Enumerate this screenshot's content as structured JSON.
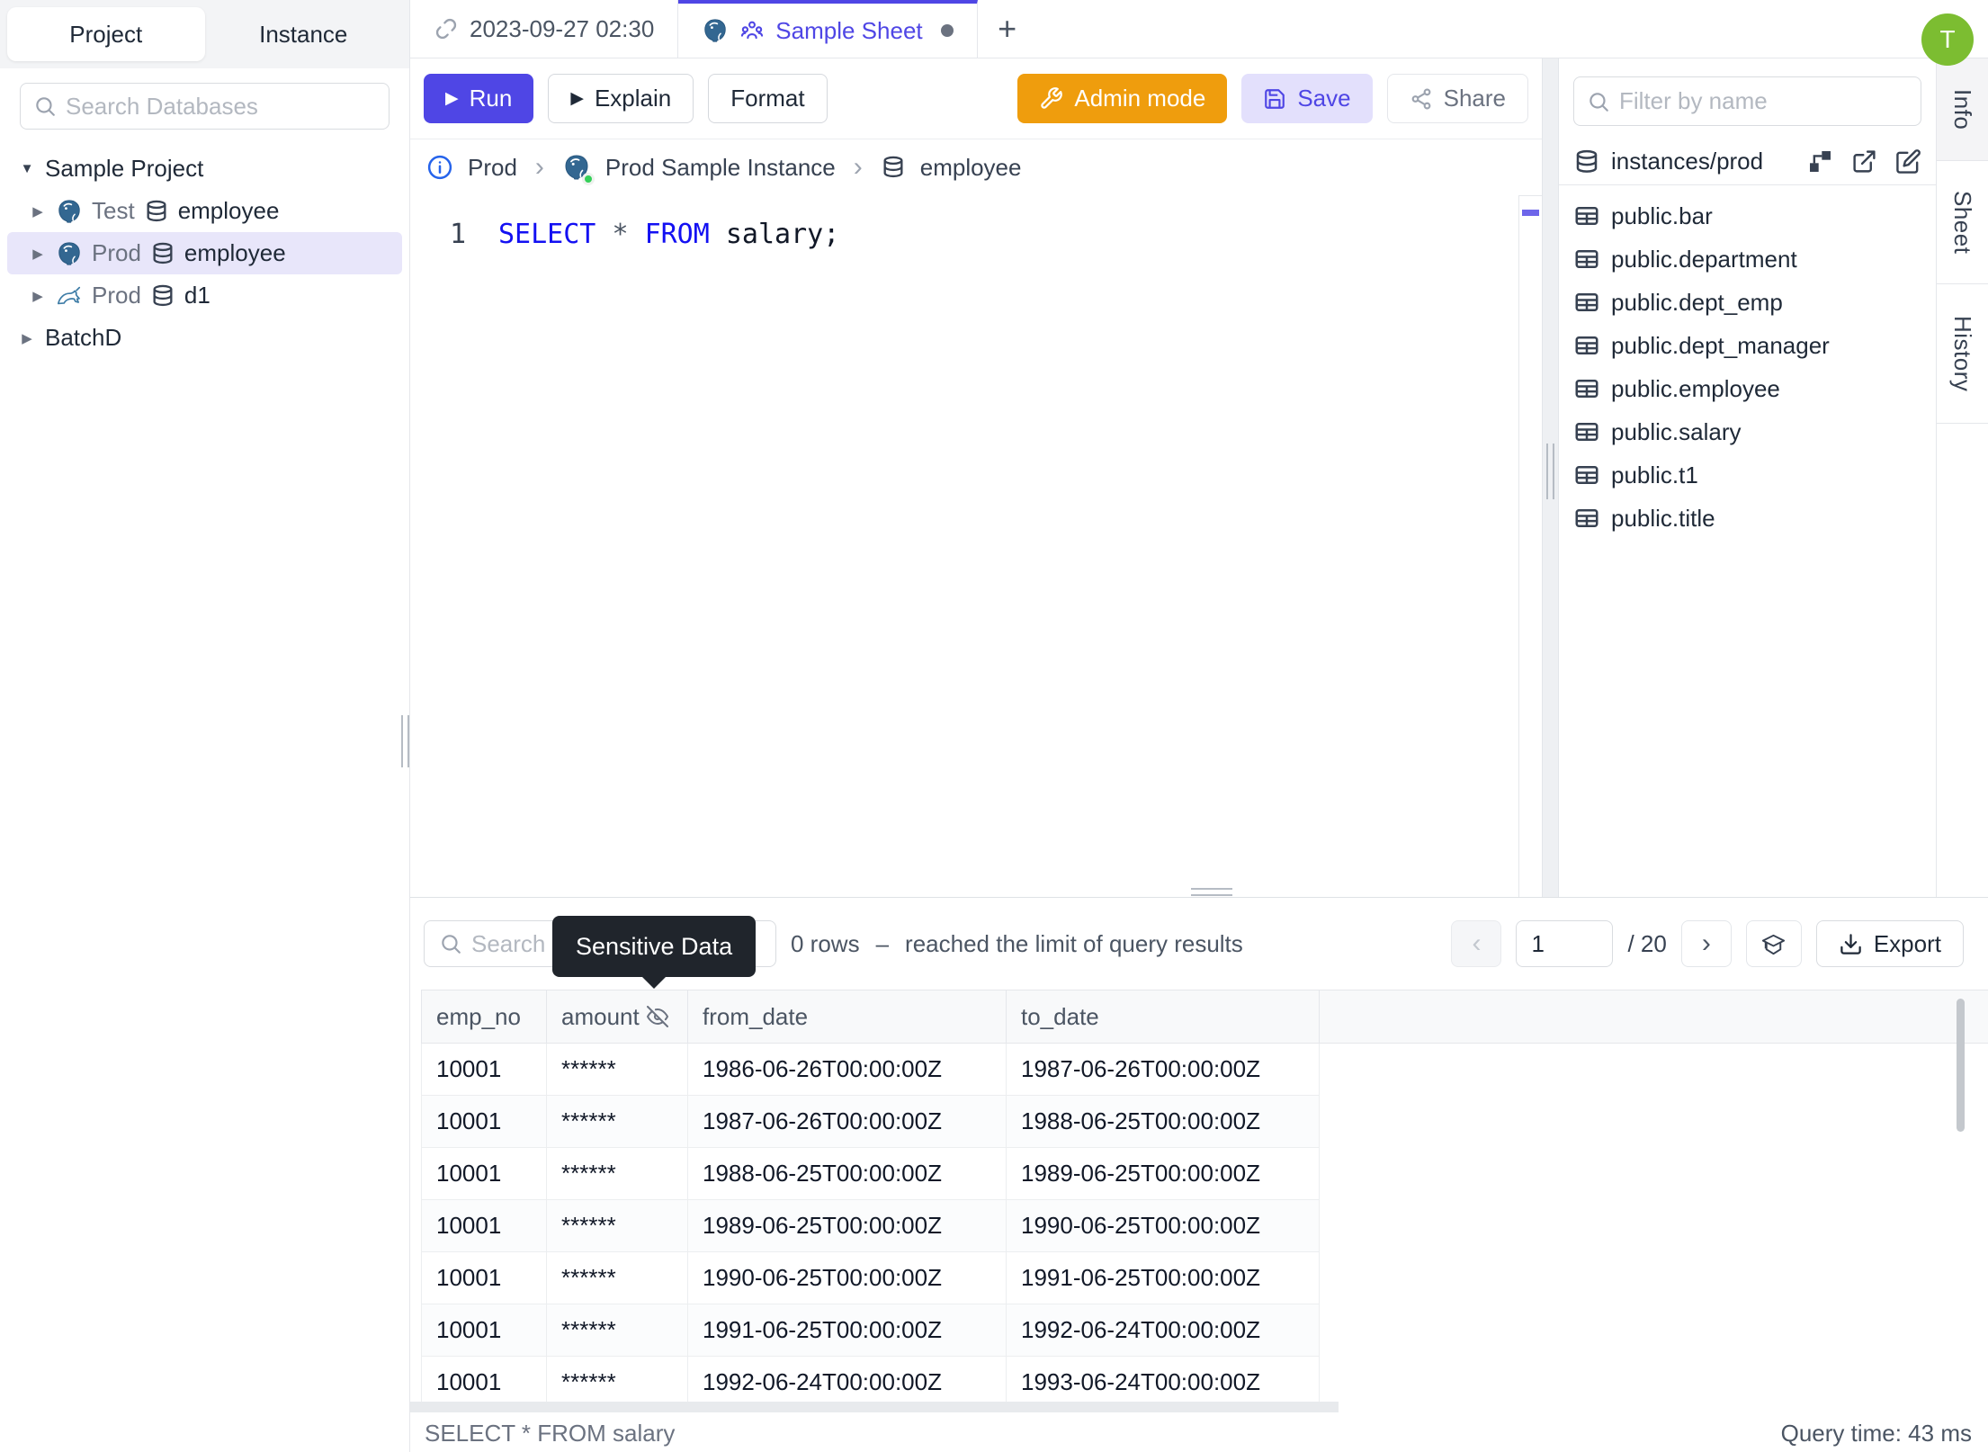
{
  "icons": {
    "play": "▶",
    "plus": "+",
    "chevron_left": "‹",
    "chevron_right": "›",
    "breadcrumb_separator": "›",
    "caret_down": "▼",
    "caret_right": "▶"
  },
  "colors": {
    "accent": "#4f46e5",
    "admin_orange": "#ef9d0d",
    "avatar_green": "#7cbd31",
    "keyword_blue": "#1310f2",
    "selected_row": "#e8e6fa"
  },
  "sidebar": {
    "tabs": {
      "project": "Project",
      "instance": "Instance"
    },
    "search_placeholder": "Search Databases",
    "tree": {
      "project": {
        "label": "Sample Project"
      },
      "items": [
        {
          "env": "Test",
          "db": "employee",
          "engine": "postgres"
        },
        {
          "env": "Prod",
          "db": "employee",
          "engine": "postgres",
          "selected": true
        },
        {
          "env": "Prod",
          "db": "d1",
          "engine": "mysql"
        }
      ],
      "batch": {
        "label": "BatchD"
      }
    }
  },
  "topbar": {
    "time_tab": {
      "label": "2023-09-27 02:30"
    },
    "sheet_tab": {
      "label": "Sample Sheet"
    },
    "avatar_initial": "T"
  },
  "toolbar": {
    "run": "Run",
    "explain": "Explain",
    "format": "Format",
    "admin_mode": "Admin mode",
    "save": "Save",
    "share": "Share"
  },
  "breadcrumb": {
    "environment": "Prod",
    "instance": "Prod Sample Instance",
    "database": "employee"
  },
  "editor": {
    "line_number": "1",
    "tokens": [
      {
        "t": "kw",
        "v": "SELECT"
      },
      {
        "t": "pl",
        "v": " "
      },
      {
        "t": "op",
        "v": "*"
      },
      {
        "t": "pl",
        "v": " "
      },
      {
        "t": "kw",
        "v": "FROM"
      },
      {
        "t": "pl",
        "v": " salary;"
      }
    ]
  },
  "right_panel": {
    "filter_placeholder": "Filter by name",
    "header": "instances/prod",
    "tables": [
      "public.bar",
      "public.department",
      "public.dept_emp",
      "public.dept_manager",
      "public.employee",
      "public.salary",
      "public.t1",
      "public.title"
    ]
  },
  "side_tabs": [
    {
      "label": "Info",
      "active": true
    },
    {
      "label": "Sheet",
      "active": false
    },
    {
      "label": "History",
      "active": false
    }
  ],
  "results": {
    "search_placeholder": "Search",
    "tooltip": "Sensitive Data",
    "rows_count": "0 rows",
    "separator": "–",
    "limit_text": "reached the limit of query results",
    "pagination": {
      "page": "1",
      "total": "/ 20",
      "export_label": "Export"
    },
    "columns": [
      {
        "label": "emp_no",
        "masked": false
      },
      {
        "label": "amount",
        "masked": true
      },
      {
        "label": "from_date",
        "masked": false
      },
      {
        "label": "to_date",
        "masked": false
      }
    ],
    "rows": [
      [
        "10001",
        "******",
        "1986-06-26T00:00:00Z",
        "1987-06-26T00:00:00Z"
      ],
      [
        "10001",
        "******",
        "1987-06-26T00:00:00Z",
        "1988-06-25T00:00:00Z"
      ],
      [
        "10001",
        "******",
        "1988-06-25T00:00:00Z",
        "1989-06-25T00:00:00Z"
      ],
      [
        "10001",
        "******",
        "1989-06-25T00:00:00Z",
        "1990-06-25T00:00:00Z"
      ],
      [
        "10001",
        "******",
        "1990-06-25T00:00:00Z",
        "1991-06-25T00:00:00Z"
      ],
      [
        "10001",
        "******",
        "1991-06-25T00:00:00Z",
        "1992-06-24T00:00:00Z"
      ],
      [
        "10001",
        "******",
        "1992-06-24T00:00:00Z",
        "1993-06-24T00:00:00Z"
      ]
    ],
    "status_left": "SELECT * FROM salary",
    "status_right": "Query time: 43 ms"
  }
}
